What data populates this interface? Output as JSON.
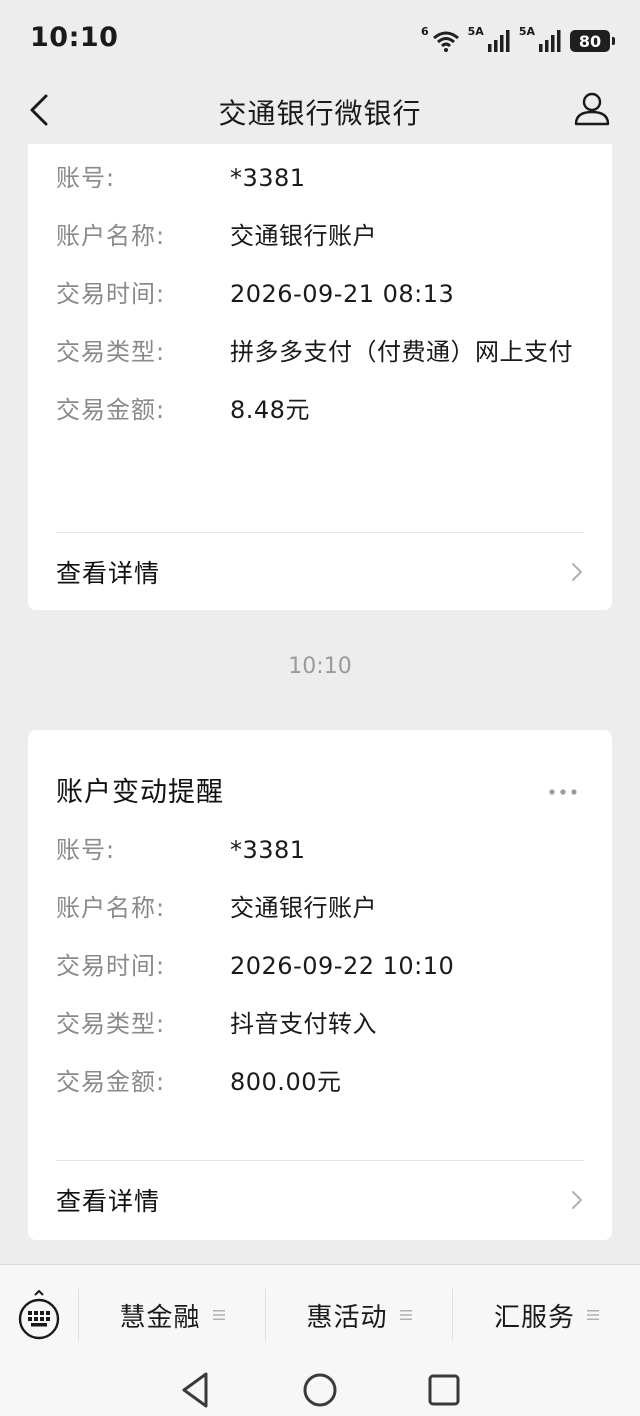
{
  "status_bar": {
    "time": "10:10",
    "wifi_label": "6",
    "signal1_label": "5A",
    "signal2_label": "5A",
    "battery": "80"
  },
  "nav": {
    "title": "交通银行微银行"
  },
  "card1": {
    "rows": [
      {
        "label": "账号:",
        "value": "*3381"
      },
      {
        "label": "账户名称:",
        "value": "交通银行账户"
      },
      {
        "label": "交易时间:",
        "value": "2026-09-21 08:13"
      },
      {
        "label": "交易类型:",
        "value": "拼多多支付（付费通）网上支付"
      },
      {
        "label": "交易金额:",
        "value": "8.48元"
      }
    ],
    "detail_label": "查看详情"
  },
  "timestamp": "10:10",
  "card2": {
    "title": "账户变动提醒",
    "rows": [
      {
        "label": "账号:",
        "value": "*3381"
      },
      {
        "label": "账户名称:",
        "value": "交通银行账户"
      },
      {
        "label": "交易时间:",
        "value": "2026-09-22 10:10"
      },
      {
        "label": "交易类型:",
        "value": "抖音支付转入"
      },
      {
        "label": "交易金额:",
        "value": "800.00元"
      }
    ],
    "detail_label": "查看详情"
  },
  "bottom_menu": {
    "items": [
      {
        "label": "慧金融"
      },
      {
        "label": "惠活动"
      },
      {
        "label": "汇服务"
      }
    ]
  }
}
